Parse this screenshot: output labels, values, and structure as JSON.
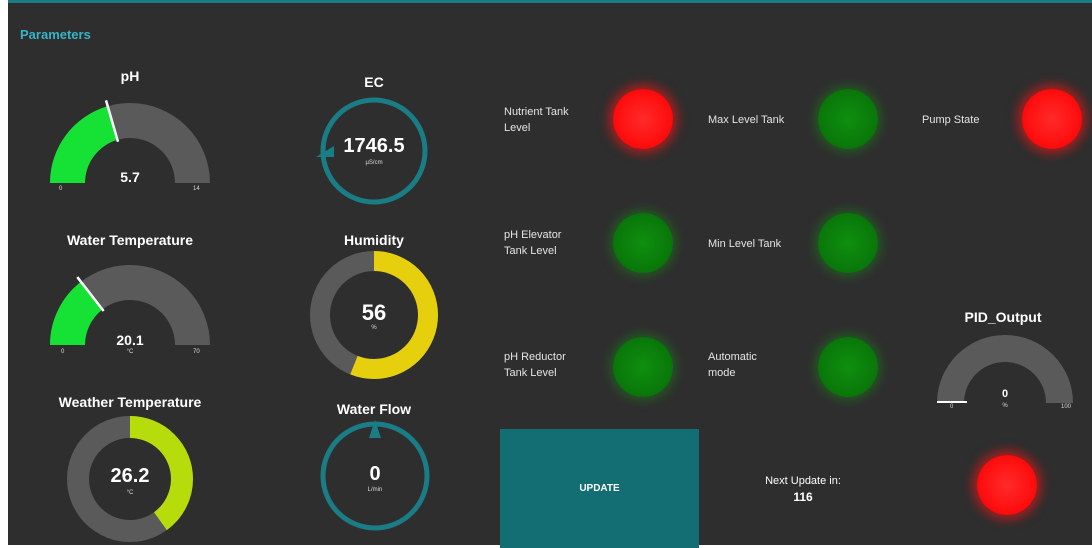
{
  "section_title": "Parameters",
  "colors": {
    "accent": "#1a7d86",
    "gauge_track": "#5a5a5a",
    "green_fill": "#15e235",
    "yellow_fill": "#e6cf0c",
    "lime_fill": "#b7dc0b",
    "teal_ring": "#1a7d86",
    "led_red": "#ff1a1a",
    "led_green": "#0a7a0a"
  },
  "gauges": {
    "ph": {
      "title": "pH",
      "value": "5.7",
      "min": "0",
      "max": "14",
      "fraction": 0.41
    },
    "water_temp": {
      "title": "Water Temperature",
      "value": "20.1",
      "unit": "°C",
      "min": "0",
      "max": "70",
      "fraction": 0.29
    },
    "weather_temp": {
      "title": "Weather Temperature",
      "value": "26.2",
      "unit": "°C",
      "fraction": 0.4
    },
    "ec": {
      "title": "EC",
      "value": "1746.5",
      "unit": "µS/cm"
    },
    "humidity": {
      "title": "Humidity",
      "value": "56",
      "unit": "%",
      "fraction": 0.56
    },
    "water_flow": {
      "title": "Water Flow",
      "value": "0",
      "unit": "L/min"
    },
    "pid": {
      "title": "PID_Output",
      "value": "0",
      "unit": "%",
      "min": "0",
      "max": "100",
      "fraction": 0.0
    }
  },
  "indicators": {
    "nutrient_tank": {
      "label": "Nutrient Tank Level",
      "state": "red"
    },
    "max_level_tank": {
      "label": "Max Level Tank",
      "state": "green"
    },
    "pump_state": {
      "label": "Pump State",
      "state": "red"
    },
    "ph_elevator": {
      "label": "pH Elevator Tank Level",
      "state": "green"
    },
    "min_level_tank": {
      "label": "Min Level Tank",
      "state": "green"
    },
    "ph_reductor": {
      "label": "pH Reductor Tank Level",
      "state": "green"
    },
    "automatic_mode": {
      "label": "Automatic mode",
      "state": "green"
    },
    "update_status": {
      "state": "red"
    }
  },
  "update": {
    "button_label": "UPDATE",
    "next_update_label": "Next Update in:",
    "next_update_value": "116"
  }
}
